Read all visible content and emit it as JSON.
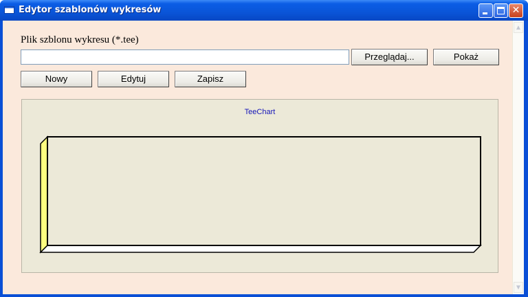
{
  "window": {
    "title": "Edytor szablonów wykresów",
    "close_glyph": "✕"
  },
  "form": {
    "file_label": "Plik szblonu wykresu (*.tee)",
    "file_value": "",
    "browse_label": "Przeglądaj...",
    "show_label": "Pokaż",
    "new_label": "Nowy",
    "edit_label": "Edytuj",
    "save_label": "Zapisz"
  },
  "chart_data": {
    "type": "line",
    "title": "TeeChart",
    "series": [],
    "wall_color": "#ffff80",
    "back_color": "#ece9d8",
    "view3d": true
  },
  "icons": {
    "window_icon": "window-icon",
    "minimize": "minimize-icon",
    "maximize": "maximize-icon",
    "close": "close-icon",
    "scroll_up": "scroll-up-arrow-icon",
    "scroll_down": "scroll-down-arrow-icon"
  }
}
